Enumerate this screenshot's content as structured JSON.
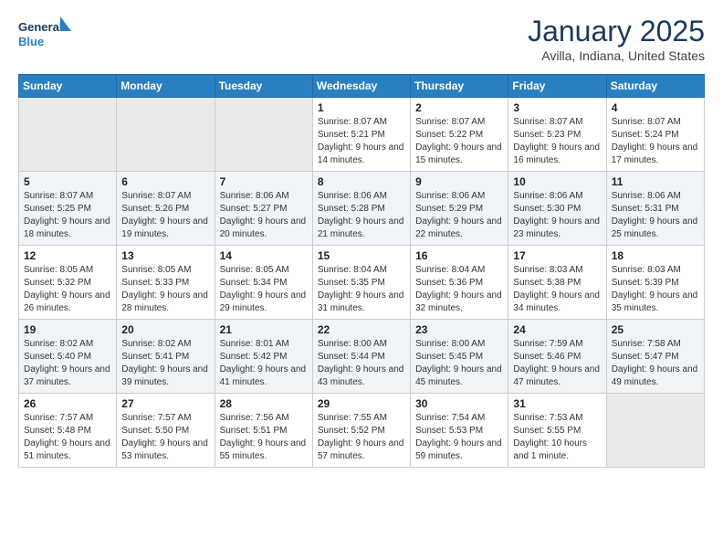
{
  "header": {
    "logo_general": "General",
    "logo_blue": "Blue",
    "month_title": "January 2025",
    "location": "Avilla, Indiana, United States"
  },
  "weekdays": [
    "Sunday",
    "Monday",
    "Tuesday",
    "Wednesday",
    "Thursday",
    "Friday",
    "Saturday"
  ],
  "weeks": [
    [
      {
        "day": "",
        "empty": true
      },
      {
        "day": "",
        "empty": true
      },
      {
        "day": "",
        "empty": true
      },
      {
        "day": "1",
        "sunrise": "8:07 AM",
        "sunset": "5:21 PM",
        "daylight": "9 hours and 14 minutes."
      },
      {
        "day": "2",
        "sunrise": "8:07 AM",
        "sunset": "5:22 PM",
        "daylight": "9 hours and 15 minutes."
      },
      {
        "day": "3",
        "sunrise": "8:07 AM",
        "sunset": "5:23 PM",
        "daylight": "9 hours and 16 minutes."
      },
      {
        "day": "4",
        "sunrise": "8:07 AM",
        "sunset": "5:24 PM",
        "daylight": "9 hours and 17 minutes."
      }
    ],
    [
      {
        "day": "5",
        "sunrise": "8:07 AM",
        "sunset": "5:25 PM",
        "daylight": "9 hours and 18 minutes."
      },
      {
        "day": "6",
        "sunrise": "8:07 AM",
        "sunset": "5:26 PM",
        "daylight": "9 hours and 19 minutes."
      },
      {
        "day": "7",
        "sunrise": "8:06 AM",
        "sunset": "5:27 PM",
        "daylight": "9 hours and 20 minutes."
      },
      {
        "day": "8",
        "sunrise": "8:06 AM",
        "sunset": "5:28 PM",
        "daylight": "9 hours and 21 minutes."
      },
      {
        "day": "9",
        "sunrise": "8:06 AM",
        "sunset": "5:29 PM",
        "daylight": "9 hours and 22 minutes."
      },
      {
        "day": "10",
        "sunrise": "8:06 AM",
        "sunset": "5:30 PM",
        "daylight": "9 hours and 23 minutes."
      },
      {
        "day": "11",
        "sunrise": "8:06 AM",
        "sunset": "5:31 PM",
        "daylight": "9 hours and 25 minutes."
      }
    ],
    [
      {
        "day": "12",
        "sunrise": "8:05 AM",
        "sunset": "5:32 PM",
        "daylight": "9 hours and 26 minutes."
      },
      {
        "day": "13",
        "sunrise": "8:05 AM",
        "sunset": "5:33 PM",
        "daylight": "9 hours and 28 minutes."
      },
      {
        "day": "14",
        "sunrise": "8:05 AM",
        "sunset": "5:34 PM",
        "daylight": "9 hours and 29 minutes."
      },
      {
        "day": "15",
        "sunrise": "8:04 AM",
        "sunset": "5:35 PM",
        "daylight": "9 hours and 31 minutes."
      },
      {
        "day": "16",
        "sunrise": "8:04 AM",
        "sunset": "5:36 PM",
        "daylight": "9 hours and 32 minutes."
      },
      {
        "day": "17",
        "sunrise": "8:03 AM",
        "sunset": "5:38 PM",
        "daylight": "9 hours and 34 minutes."
      },
      {
        "day": "18",
        "sunrise": "8:03 AM",
        "sunset": "5:39 PM",
        "daylight": "9 hours and 35 minutes."
      }
    ],
    [
      {
        "day": "19",
        "sunrise": "8:02 AM",
        "sunset": "5:40 PM",
        "daylight": "9 hours and 37 minutes."
      },
      {
        "day": "20",
        "sunrise": "8:02 AM",
        "sunset": "5:41 PM",
        "daylight": "9 hours and 39 minutes."
      },
      {
        "day": "21",
        "sunrise": "8:01 AM",
        "sunset": "5:42 PM",
        "daylight": "9 hours and 41 minutes."
      },
      {
        "day": "22",
        "sunrise": "8:00 AM",
        "sunset": "5:44 PM",
        "daylight": "9 hours and 43 minutes."
      },
      {
        "day": "23",
        "sunrise": "8:00 AM",
        "sunset": "5:45 PM",
        "daylight": "9 hours and 45 minutes."
      },
      {
        "day": "24",
        "sunrise": "7:59 AM",
        "sunset": "5:46 PM",
        "daylight": "9 hours and 47 minutes."
      },
      {
        "day": "25",
        "sunrise": "7:58 AM",
        "sunset": "5:47 PM",
        "daylight": "9 hours and 49 minutes."
      }
    ],
    [
      {
        "day": "26",
        "sunrise": "7:57 AM",
        "sunset": "5:48 PM",
        "daylight": "9 hours and 51 minutes."
      },
      {
        "day": "27",
        "sunrise": "7:57 AM",
        "sunset": "5:50 PM",
        "daylight": "9 hours and 53 minutes."
      },
      {
        "day": "28",
        "sunrise": "7:56 AM",
        "sunset": "5:51 PM",
        "daylight": "9 hours and 55 minutes."
      },
      {
        "day": "29",
        "sunrise": "7:55 AM",
        "sunset": "5:52 PM",
        "daylight": "9 hours and 57 minutes."
      },
      {
        "day": "30",
        "sunrise": "7:54 AM",
        "sunset": "5:53 PM",
        "daylight": "9 hours and 59 minutes."
      },
      {
        "day": "31",
        "sunrise": "7:53 AM",
        "sunset": "5:55 PM",
        "daylight": "10 hours and 1 minute."
      },
      {
        "day": "",
        "empty": true
      }
    ]
  ]
}
